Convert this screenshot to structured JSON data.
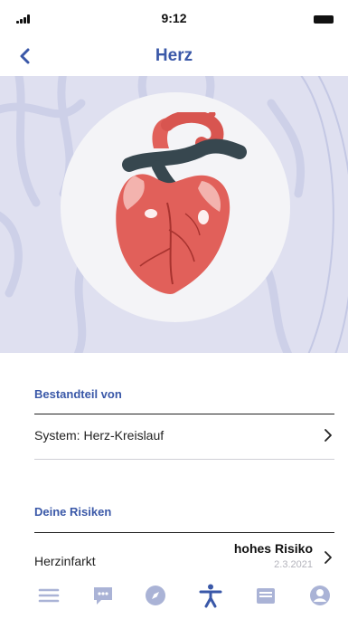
{
  "status_bar": {
    "time": "9:12"
  },
  "nav": {
    "title": "Herz",
    "back_icon": "chevron-left-icon"
  },
  "hero": {
    "image": "heart-illustration"
  },
  "section_part_of": {
    "title": "Bestandteil von",
    "items": [
      {
        "label": "System: Herz-Kreislauf"
      }
    ]
  },
  "section_risks": {
    "title": "Deine Risiken",
    "items": [
      {
        "label": "Herzinfarkt",
        "level": "hohes Risiko",
        "date": "2.3.2021"
      }
    ]
  },
  "tab_bar": {
    "items": [
      {
        "icon": "menu-icon",
        "active": false
      },
      {
        "icon": "chat-icon",
        "active": false
      },
      {
        "icon": "compass-icon",
        "active": false
      },
      {
        "icon": "body-icon",
        "active": true
      },
      {
        "icon": "inbox-icon",
        "active": false
      },
      {
        "icon": "profile-icon",
        "active": false
      }
    ]
  },
  "colors": {
    "accent": "#3a58a8",
    "inactive_icon": "#aab3d6",
    "hero_bg": "#dfe0f0",
    "heart": "#e1605a"
  }
}
